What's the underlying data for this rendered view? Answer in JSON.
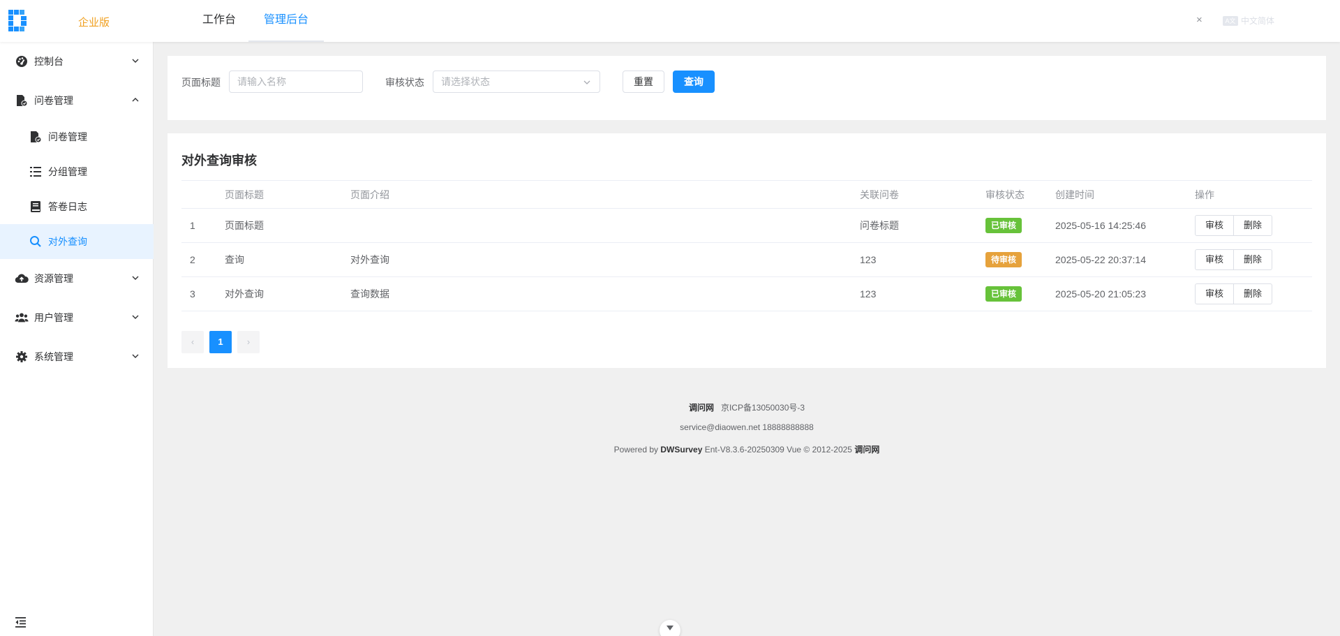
{
  "header": {
    "edition": "企业版",
    "nav": [
      "工作台",
      "管理后台"
    ],
    "close_label": "×",
    "lang_label": "中文简体",
    "lang_badge": "A文"
  },
  "sidebar": {
    "items": [
      {
        "label": "控制台",
        "icon": "dashboard-icon"
      },
      {
        "label": "问卷管理",
        "icon": "survey-icon"
      },
      {
        "label": "问卷管理",
        "icon": "survey-check-icon"
      },
      {
        "label": "分组管理",
        "icon": "list-icon"
      },
      {
        "label": "答卷日志",
        "icon": "book-icon"
      },
      {
        "label": "对外查询",
        "icon": "search-icon"
      },
      {
        "label": "资源管理",
        "icon": "cloud-upload-icon"
      },
      {
        "label": "用户管理",
        "icon": "users-icon"
      },
      {
        "label": "系统管理",
        "icon": "gear-icon"
      }
    ]
  },
  "filters": {
    "title_label": "页面标题",
    "title_placeholder": "请输入名称",
    "status_label": "审核状态",
    "status_placeholder": "请选择状态",
    "reset_label": "重置",
    "query_label": "查询"
  },
  "table": {
    "title": "对外查询审核",
    "columns": [
      "页面标题",
      "页面介绍",
      "关联问卷",
      "审核状态",
      "创建时间",
      "操作"
    ],
    "rows": [
      {
        "index": "1",
        "title": "页面标题",
        "intro": "",
        "survey": "问卷标题",
        "status": "已审核",
        "status_color": "#67c23a",
        "created": "2025-05-16 14:25:46",
        "review": "审核",
        "delete": "删除"
      },
      {
        "index": "2",
        "title": "查询",
        "intro": "对外查询",
        "survey": "123",
        "status": "待审核",
        "status_color": "#e6a23c",
        "created": "2025-05-22 20:37:14",
        "review": "审核",
        "delete": "删除"
      },
      {
        "index": "3",
        "title": "对外查询",
        "intro": "查询数据",
        "survey": "123",
        "status": "已审核",
        "status_color": "#67c23a",
        "created": "2025-05-20 21:05:23",
        "review": "审核",
        "delete": "删除"
      }
    ]
  },
  "pagination": {
    "prev": "‹",
    "page": "1",
    "next": "›"
  },
  "footer": {
    "site": "调问网",
    "icp": "京ICP备13050030号-3",
    "contact": "service@diaowen.net 18888888888",
    "powered_prefix": "Powered by",
    "product": "DWSurvey",
    "version": "Ent-V8.3.6-20250309 Vue © 2012-2025",
    "owner": "调问网"
  },
  "colors": {
    "primary": "#1890ff",
    "success": "#67c23a",
    "warning": "#e6a23c",
    "edition": "#f0a020"
  }
}
